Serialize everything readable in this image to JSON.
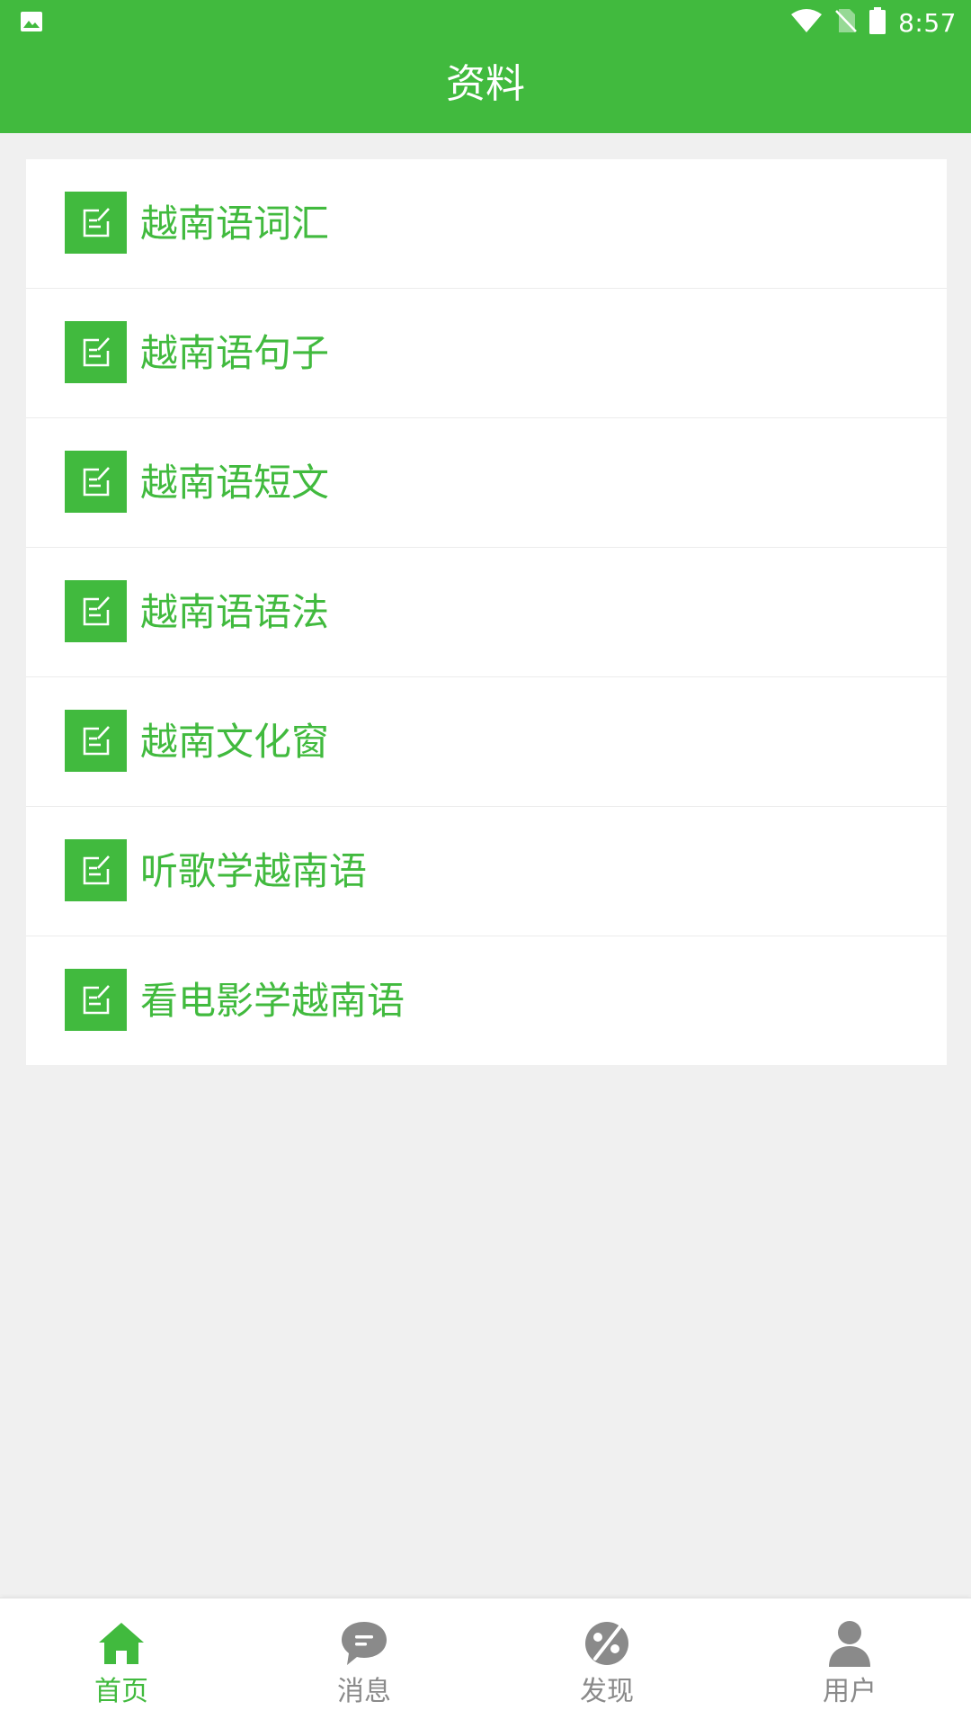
{
  "status_bar": {
    "time": "8:57",
    "icons": [
      "image-icon",
      "wifi-icon",
      "no-sim-icon",
      "battery-icon"
    ]
  },
  "header": {
    "title": "资料"
  },
  "list": {
    "items": [
      {
        "label": "越南语词汇",
        "icon": "edit-note-icon"
      },
      {
        "label": "越南语句子",
        "icon": "edit-note-icon"
      },
      {
        "label": "越南语短文",
        "icon": "edit-note-icon"
      },
      {
        "label": "越南语语法",
        "icon": "edit-note-icon"
      },
      {
        "label": "越南文化窗",
        "icon": "edit-note-icon"
      },
      {
        "label": "听歌学越南语",
        "icon": "edit-note-icon"
      },
      {
        "label": "看电影学越南语",
        "icon": "edit-note-icon"
      }
    ]
  },
  "bottom_nav": {
    "items": [
      {
        "label": "首页",
        "icon": "home-icon",
        "active": true
      },
      {
        "label": "消息",
        "icon": "chat-bubble-icon",
        "active": false
      },
      {
        "label": "发现",
        "icon": "discover-icon",
        "active": false
      },
      {
        "label": "用户",
        "icon": "user-icon",
        "active": false
      }
    ]
  },
  "colors": {
    "accent": "#41ba3e",
    "background": "#f0f0f0",
    "inactive": "#8a8a8a"
  }
}
